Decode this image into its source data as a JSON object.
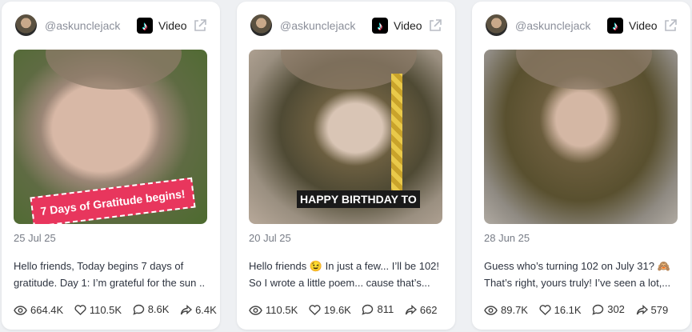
{
  "cards": [
    {
      "handle": "@askunclejack",
      "platform_icon": "tiktok-icon",
      "type_label": "Video",
      "overlay_text": "7 Days of Gratitude begins!",
      "date": "25 Jul 25",
      "desc_line1": "Hello friends, Today begins 7 days of",
      "desc_line2": "gratitude. Day 1: I’m grateful for the sun ...",
      "views": "664.4K",
      "likes": "110.5K",
      "comments": "8.6K",
      "shares": "6.4K"
    },
    {
      "handle": "@askunclejack",
      "platform_icon": "tiktok-icon",
      "type_label": "Video",
      "overlay_text": "HAPPY BIRTHDAY TO",
      "date": "20 Jul 25",
      "desc_line1": "Hello friends 😉 In just a few... I’ll be 102!",
      "desc_line2": "So I wrote a little poem... cause that’s...",
      "views": "110.5K",
      "likes": "19.6K",
      "comments": "811",
      "shares": "662"
    },
    {
      "handle": "@askunclejack",
      "platform_icon": "tiktok-icon",
      "type_label": "Video",
      "date": "28 Jun 25",
      "desc_line1": "Guess who’s turning 102 on July 31? 🙈",
      "desc_line2": "That’s right, yours truly! I’ve seen a lot,...",
      "views": "89.7K",
      "likes": "16.1K",
      "comments": "302",
      "shares": "579"
    }
  ],
  "colors": {
    "banner": "#e8365d",
    "muted": "#8b8f9a"
  }
}
